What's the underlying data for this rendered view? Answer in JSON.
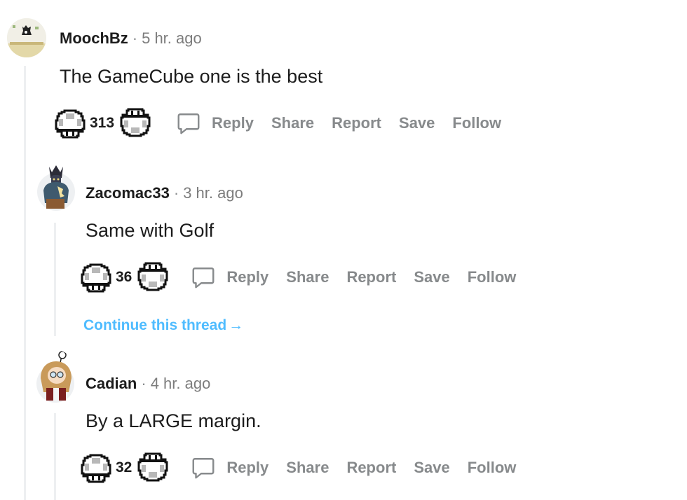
{
  "comments": [
    {
      "author": "MoochBz",
      "separator": "·",
      "time": "5 hr. ago",
      "body": "The GameCube one is the best",
      "score": "313",
      "actions": {
        "reply": "Reply",
        "share": "Share",
        "report": "Report",
        "save": "Save",
        "follow": "Follow"
      }
    },
    {
      "author": "Zacomac33",
      "separator": "·",
      "time": "3 hr. ago",
      "body": "Same with Golf",
      "score": "36",
      "actions": {
        "reply": "Reply",
        "share": "Share",
        "report": "Report",
        "save": "Save",
        "follow": "Follow"
      }
    },
    {
      "author": "Cadian",
      "separator": "·",
      "time": "4 hr. ago",
      "body": "By a LARGE margin.",
      "score": "32",
      "actions": {
        "reply": "Reply",
        "share": "Share",
        "report": "Report",
        "save": "Save",
        "follow": "Follow"
      }
    }
  ],
  "continue_thread": {
    "label": "Continue this thread",
    "arrow": "→"
  },
  "icons": {
    "upvote": "mushroom-upvote-icon",
    "downvote": "mushroom-downvote-icon",
    "reply": "chat-bubble-icon"
  },
  "colors": {
    "author": "#1c1c1c",
    "muted": "#878a8c",
    "link": "#4fbcff",
    "thread_line": "#edeff1"
  }
}
